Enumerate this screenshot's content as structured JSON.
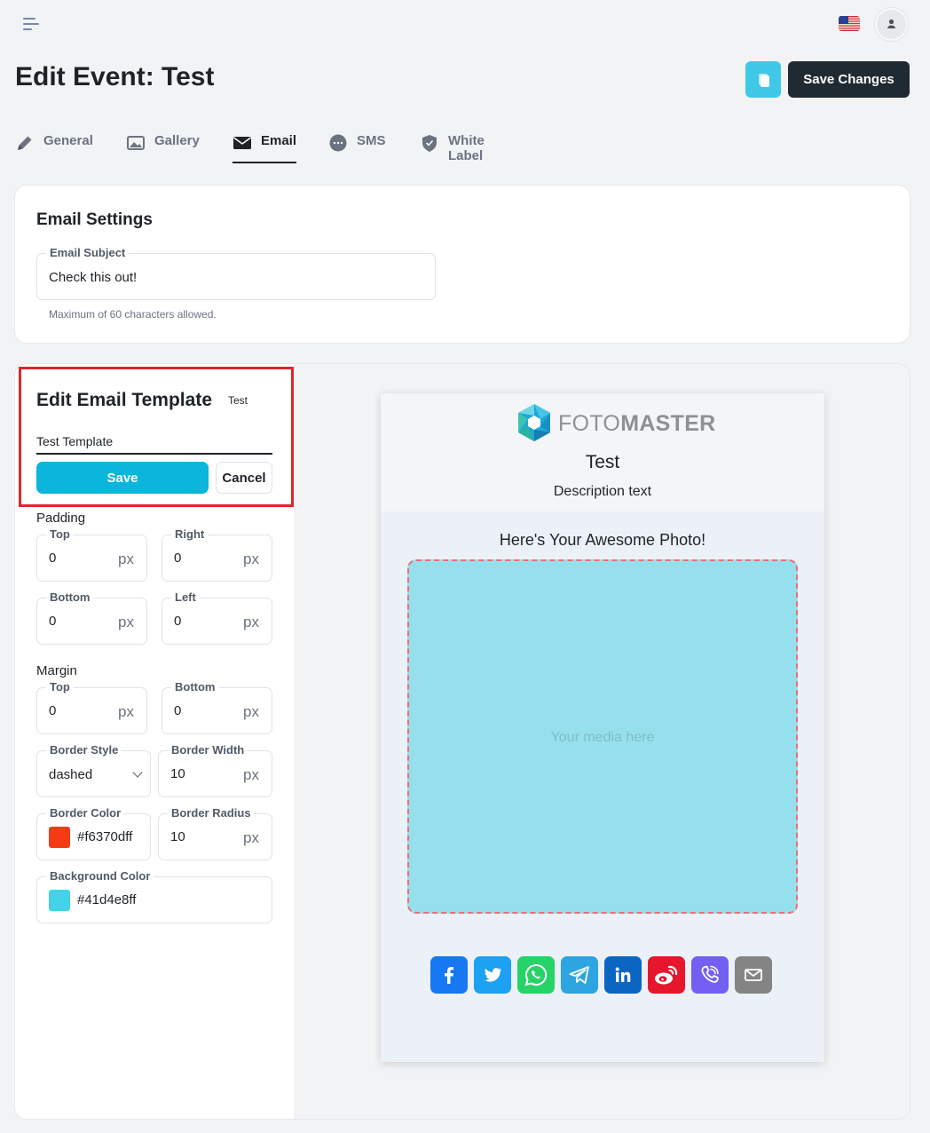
{
  "header": {
    "page_title": "Edit Event: Test",
    "save_changes_label": "Save Changes",
    "flag_icon": "us-flag-icon",
    "avatar_icon": "user-icon"
  },
  "tabs": [
    {
      "label": "General",
      "icon": "pencil-icon",
      "active": false
    },
    {
      "label": "Gallery",
      "icon": "image-icon",
      "active": false
    },
    {
      "label": "Email",
      "icon": "envelope-icon",
      "active": true
    },
    {
      "label": "SMS",
      "icon": "chat-icon",
      "active": false
    },
    {
      "label": "White Label",
      "icon": "shield-icon",
      "active": false
    }
  ],
  "email_settings": {
    "title": "Email Settings",
    "subject_label": "Email Subject",
    "subject_value": "Check this out!",
    "hint": "Maximum of 60 characters allowed."
  },
  "template_editor": {
    "title": "Edit Email Template",
    "badge": "Test",
    "name_value": "Test Template",
    "save_label": "Save",
    "cancel_label": "Cancel",
    "padding_label": "Padding",
    "padding": {
      "top_label": "Top",
      "top": "0",
      "right_label": "Right",
      "right": "0",
      "bottom_label": "Bottom",
      "bottom": "0",
      "left_label": "Left",
      "left": "0"
    },
    "margin_label": "Margin",
    "margin": {
      "top_label": "Top",
      "top": "0",
      "bottom_label": "Bottom",
      "bottom": "0"
    },
    "unit": "px",
    "border_style_label": "Border Style",
    "border_style": "dashed",
    "border_width_label": "Border Width",
    "border_width": "10",
    "border_color_label": "Border Color",
    "border_color": "#f6370dff",
    "border_color_swatch": "#f53a14",
    "border_radius_label": "Border Radius",
    "border_radius": "10",
    "background_color_label": "Background Color",
    "background_color": "#41d4e8ff",
    "background_color_swatch": "#41d4e8"
  },
  "preview": {
    "logo_light": "FOTO",
    "logo_bold": "MASTER",
    "title": "Test",
    "description": "Description text",
    "heading": "Here's Your Awesome Photo!",
    "media_placeholder": "Your media here",
    "share_icons": [
      "facebook-icon",
      "twitter-icon",
      "whatsapp-icon",
      "telegram-icon",
      "linkedin-icon",
      "weibo-icon",
      "viber-icon",
      "email-icon"
    ],
    "share_colors": [
      "#1877f2",
      "#1da1f2",
      "#25d366",
      "#2ca5e0",
      "#0a66c2",
      "#e6162d",
      "#7360f2",
      "#848484"
    ]
  }
}
